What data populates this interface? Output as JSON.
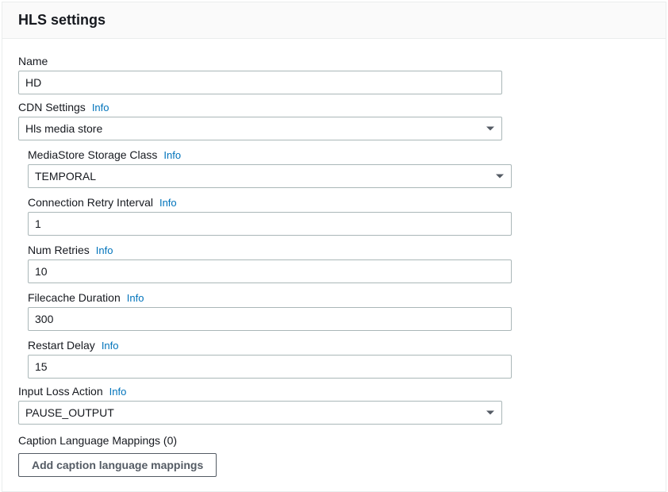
{
  "panel": {
    "title": "HLS settings"
  },
  "labels": {
    "info": "Info"
  },
  "fields": {
    "name": {
      "label": "Name",
      "value": "HD"
    },
    "cdn_settings": {
      "label": "CDN Settings",
      "value": "Hls media store"
    },
    "mediastore_storage_class": {
      "label": "MediaStore Storage Class",
      "value": "TEMPORAL"
    },
    "connection_retry_interval": {
      "label": "Connection Retry Interval",
      "value": "1"
    },
    "num_retries": {
      "label": "Num Retries",
      "value": "10"
    },
    "filecache_duration": {
      "label": "Filecache Duration",
      "value": "300"
    },
    "restart_delay": {
      "label": "Restart Delay",
      "value": "15"
    },
    "input_loss_action": {
      "label": "Input Loss Action",
      "value": "PAUSE_OUTPUT"
    }
  },
  "caption": {
    "title": "Caption Language Mappings (0)",
    "button": "Add caption language mappings"
  }
}
